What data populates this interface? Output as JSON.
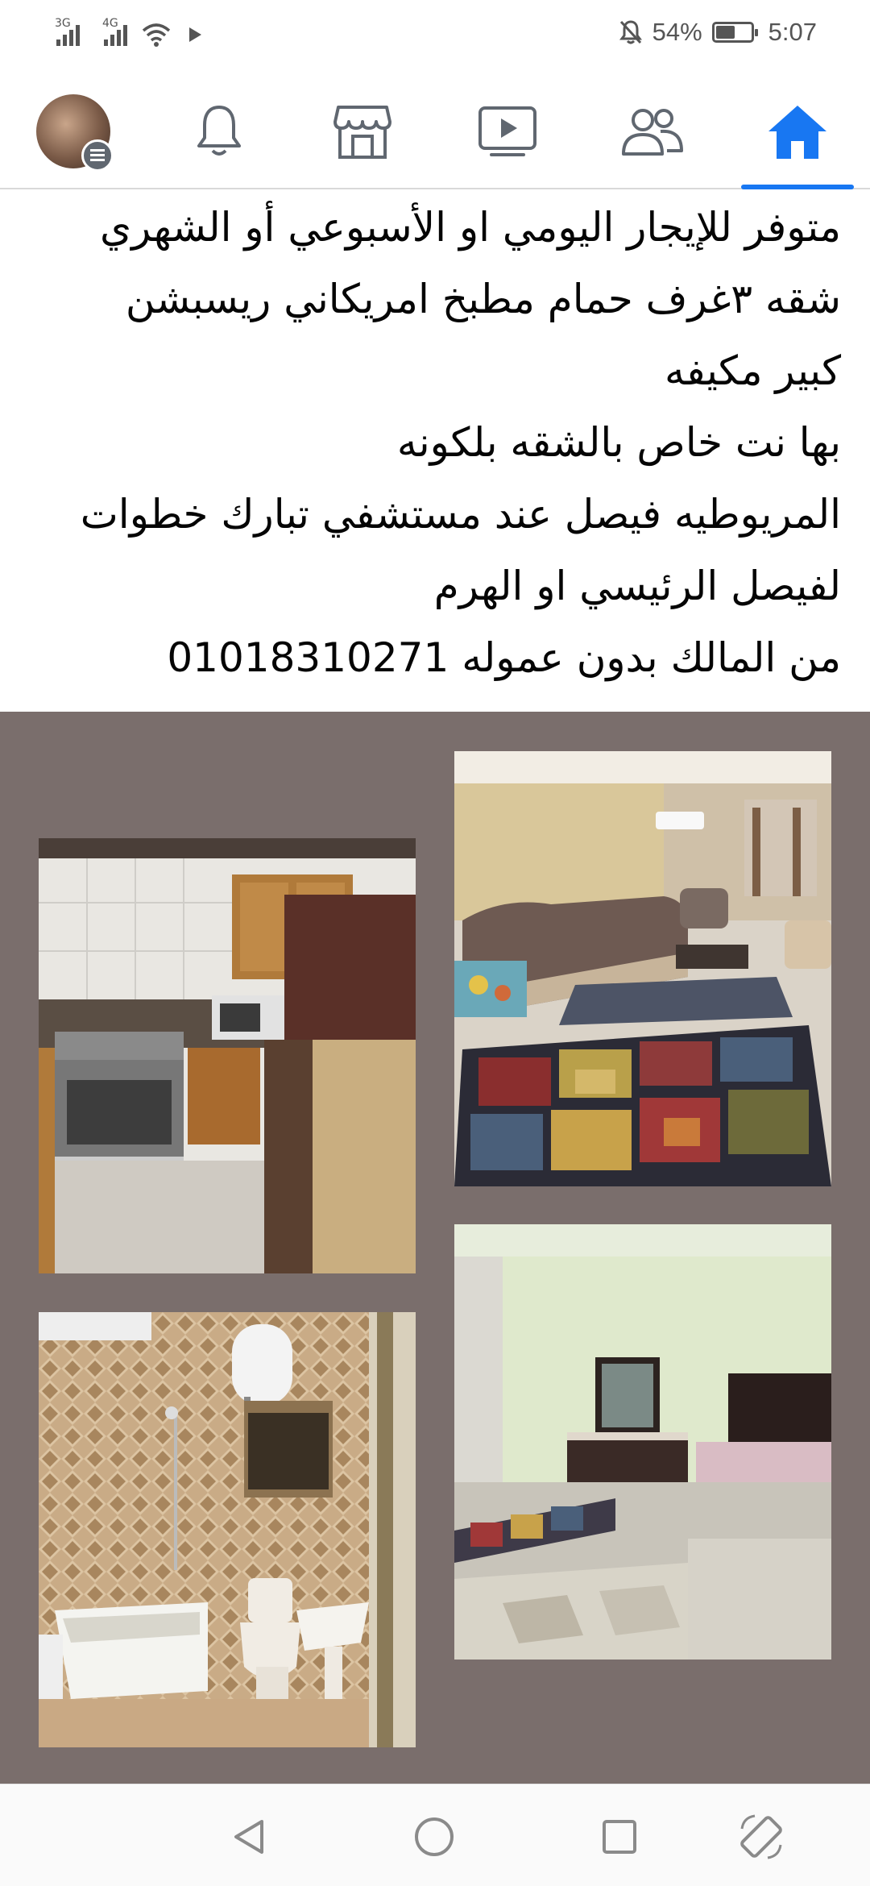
{
  "status_bar": {
    "signal_1_label": "3G",
    "signal_2_label": "4G",
    "battery_percent": "54%",
    "battery_level": 0.54,
    "time": "5:07",
    "icons": [
      "signal-icon",
      "signal-icon",
      "wifi-icon",
      "play-icon",
      "mute-icon",
      "battery-icon"
    ]
  },
  "nav_bar": {
    "active_tab": "home",
    "tabs": [
      {
        "name": "profile-menu",
        "icon": "avatar-menu-icon"
      },
      {
        "name": "notifications",
        "icon": "bell-icon"
      },
      {
        "name": "marketplace",
        "icon": "store-icon"
      },
      {
        "name": "watch",
        "icon": "video-icon"
      },
      {
        "name": "groups",
        "icon": "people-icon"
      },
      {
        "name": "home",
        "icon": "home-icon"
      }
    ],
    "accent_color": "#1877f2"
  },
  "post": {
    "lines": [
      "متوفر للإيجار اليومي او الأسبوعي أو الشهري",
      "شقه ٣غرف حمام مطبخ امريكاني ريسبشن",
      "كبير مكيفه",
      "بها نت خاص بالشقه بلكونه",
      "المريوطيه فيصل عند مستشفي تبارك خطوات",
      "لفيصل الرئيسي او الهرم",
      "من المالك بدون عموله 01018310271"
    ]
  },
  "photos": [
    {
      "name": "living-room-photo"
    },
    {
      "name": "kitchen-photo"
    },
    {
      "name": "bedroom-photo"
    },
    {
      "name": "bathroom-photo"
    }
  ],
  "android_nav": {
    "icons": [
      "back-icon",
      "home-circle-icon",
      "recents-icon",
      "rotate-icon"
    ]
  }
}
